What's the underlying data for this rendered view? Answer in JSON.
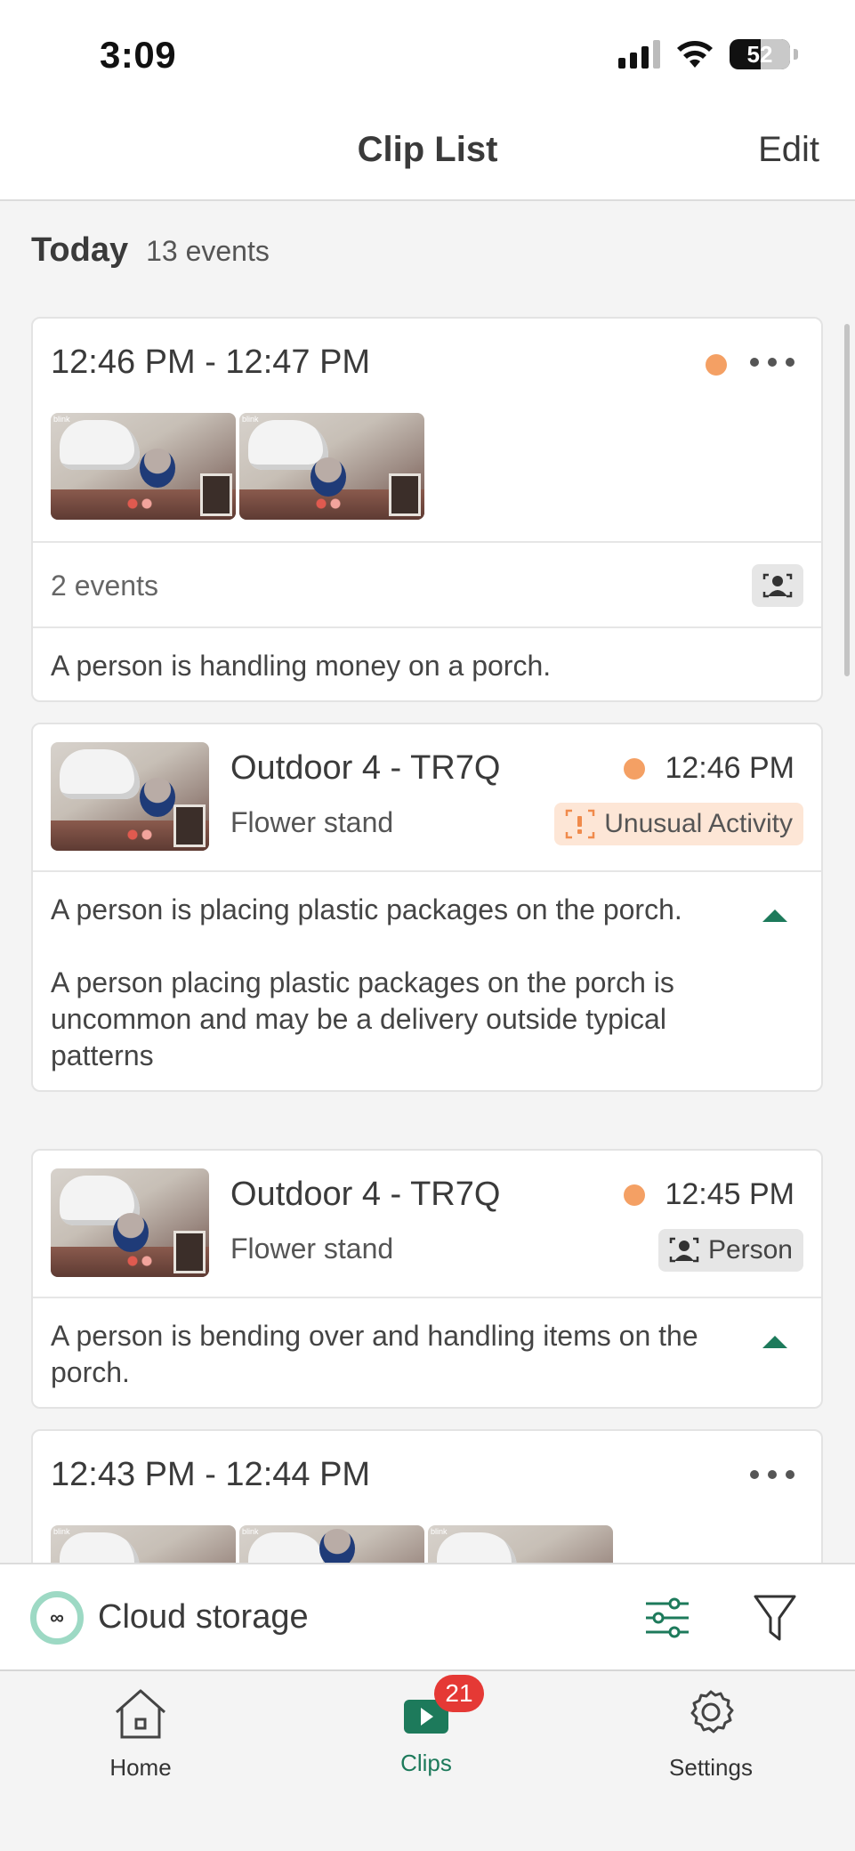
{
  "status": {
    "time": "3:09",
    "battery": "52"
  },
  "nav": {
    "title": "Clip List",
    "edit_label": "Edit"
  },
  "day": {
    "title": "Today",
    "count": "13 events"
  },
  "groups": [
    {
      "time_range": "12:46 PM - 12:47 PM",
      "events_label": "2 events",
      "summary": "A person is handling money on a porch.",
      "thumb_logo": "blink"
    },
    {
      "time_range": "12:43 PM - 12:44 PM",
      "thumb_logo": "blink"
    }
  ],
  "events": [
    {
      "camera": "Outdoor 4 - TR7Q",
      "location": "Flower stand",
      "time": "12:46 PM",
      "tag": "Unusual Activity",
      "description": "A person is placing plastic packages on the porch.",
      "detail": "A person placing plastic packages on the porch is uncommon and may be a delivery outside typical patterns"
    },
    {
      "camera": "Outdoor 4 - TR7Q",
      "location": "Flower stand",
      "time": "12:45 PM",
      "tag": "Person",
      "description": "A person is bending over and handling items on the porch."
    }
  ],
  "bottom": {
    "cloud_label": "Cloud storage",
    "cloud_icon_glyph": "∞"
  },
  "tabs": {
    "home": "Home",
    "clips": "Clips",
    "clips_badge": "21",
    "settings": "Settings"
  },
  "colors": {
    "accent": "#1d7a5b",
    "dot": "#f4a064",
    "badge": "#e53935",
    "cloud_ring": "#9dd9c4"
  },
  "icons": [
    "signal-icon",
    "wifi-icon",
    "battery-icon",
    "more-icon",
    "person-icon",
    "unusual-activity-icon",
    "caret-up-icon",
    "cloud-storage-icon",
    "sliders-icon",
    "filter-icon",
    "home-icon",
    "clips-icon",
    "settings-icon"
  ]
}
